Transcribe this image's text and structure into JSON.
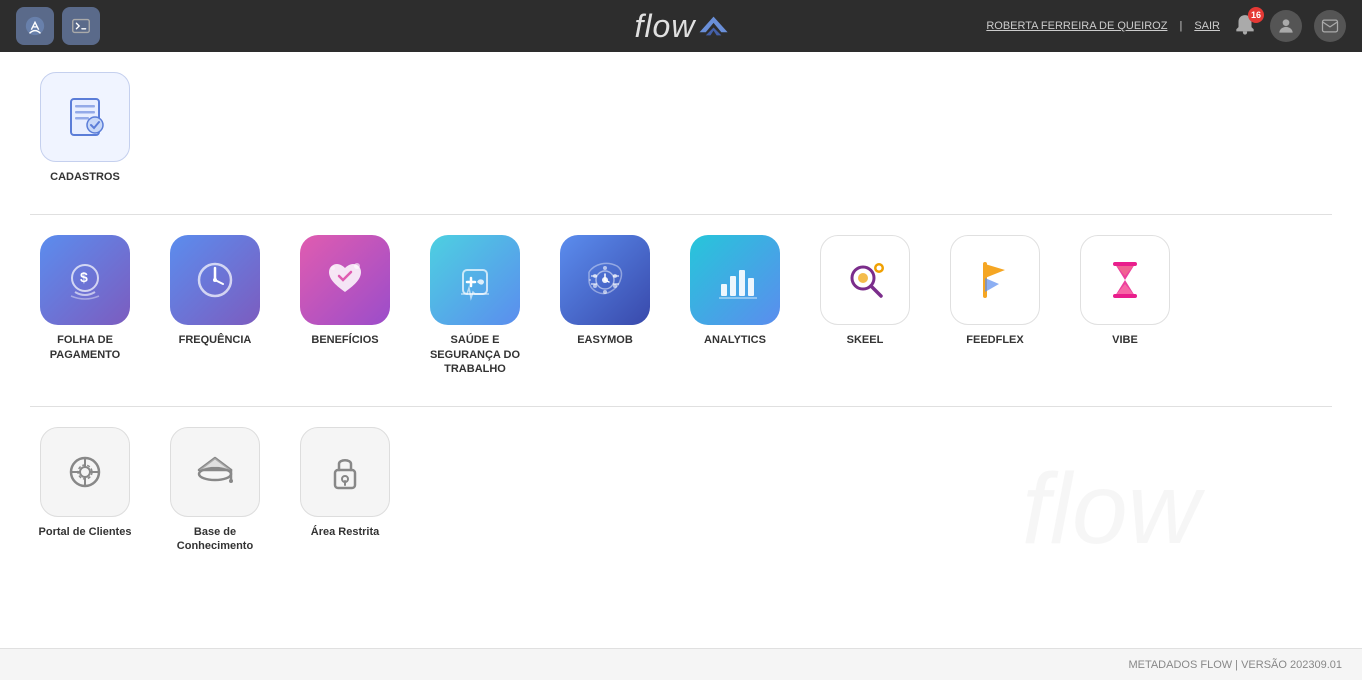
{
  "header": {
    "logo_text": "flow",
    "user_name": "ROBERTA FERREIRA DE QUEIROZ",
    "sair_label": "SAIR",
    "notification_count": "16"
  },
  "sections": {
    "cadastros": {
      "label": "CADASTROS",
      "icon_type": "document"
    },
    "apps_label": "",
    "apps": [
      {
        "id": "folha",
        "label": "FOLHA DE PAGAMENTO",
        "bg": "bg-blue-purple",
        "icon": "money"
      },
      {
        "id": "frequencia",
        "label": "FREQUÊNCIA",
        "bg": "bg-blue-purple",
        "icon": "clock"
      },
      {
        "id": "beneficios",
        "label": "BENEFÍCIOS",
        "bg": "bg-pink-purple",
        "icon": "heart"
      },
      {
        "id": "saude",
        "label": "SAÚDE E SEGURANÇA DO TRABALHO",
        "bg": "bg-teal-blue",
        "icon": "health"
      },
      {
        "id": "easymob",
        "label": "EASYMOB",
        "bg": "bg-blue-indigo",
        "icon": "easymob"
      },
      {
        "id": "analytics",
        "label": "ANALYTICS",
        "bg": "bg-cyan-blue",
        "icon": "chart"
      },
      {
        "id": "skeel",
        "label": "SKEEL",
        "bg": "bg-white-outline",
        "icon": "search"
      },
      {
        "id": "feedflex",
        "label": "FEEDFLEX",
        "bg": "bg-amber",
        "icon": "feedflex"
      },
      {
        "id": "vibe",
        "label": "VIBE",
        "bg": "bg-pink-magenta",
        "icon": "vibe"
      }
    ],
    "utilities": [
      {
        "id": "portal",
        "label": "Portal de Clientes",
        "icon": "gear"
      },
      {
        "id": "base",
        "label": "Base de Conhecimento",
        "icon": "graduation"
      },
      {
        "id": "restrita",
        "label": "Área Restrita",
        "icon": "lock"
      }
    ]
  },
  "footer": {
    "text": "METADADOS FLOW | VERSÃO 202309.01"
  }
}
